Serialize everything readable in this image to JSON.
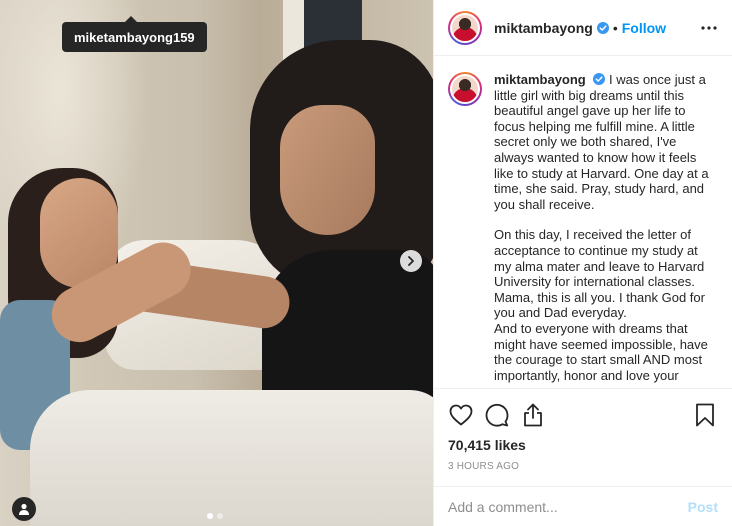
{
  "tooltip": {
    "username": "miketambayong159"
  },
  "photo": {
    "carousel_dots": 2,
    "active_dot": 1
  },
  "header": {
    "username": "miktambayong",
    "separator": "•",
    "follow_label": "Follow"
  },
  "caption": {
    "username": "miktambayong",
    "paragraph1": "I was once just a little girl with big dreams until this beautiful angel gave up her life to focus helping me fulfill mine. A little secret only we both shared, I've always wanted to know how it feels like to study at Harvard. One day at a time, she said. Pray, study hard, and you shall receive.",
    "paragraph2": "On this day, I received the letter of acceptance to continue my study at my alma mater and leave to Harvard University for international classes. Mama, this is all you. I thank God for you and Dad everyday.",
    "paragraph3": "And to everyone with dreams that might have seemed impossible, have the courage to start small AND most importantly, honor and love your"
  },
  "stats": {
    "likes": "70,415 likes",
    "time": "3 HOURS AGO"
  },
  "comment": {
    "placeholder": "Add a comment...",
    "post_label": "Post"
  },
  "colors": {
    "accent": "#0095f6",
    "post_disabled": "#b2dffc",
    "muted": "#8e8e8e"
  },
  "icons": [
    "heart-icon",
    "comment-icon",
    "share-icon",
    "bookmark-icon",
    "more-icon",
    "verified-icon",
    "chevron-right-icon",
    "user-tag-icon"
  ]
}
